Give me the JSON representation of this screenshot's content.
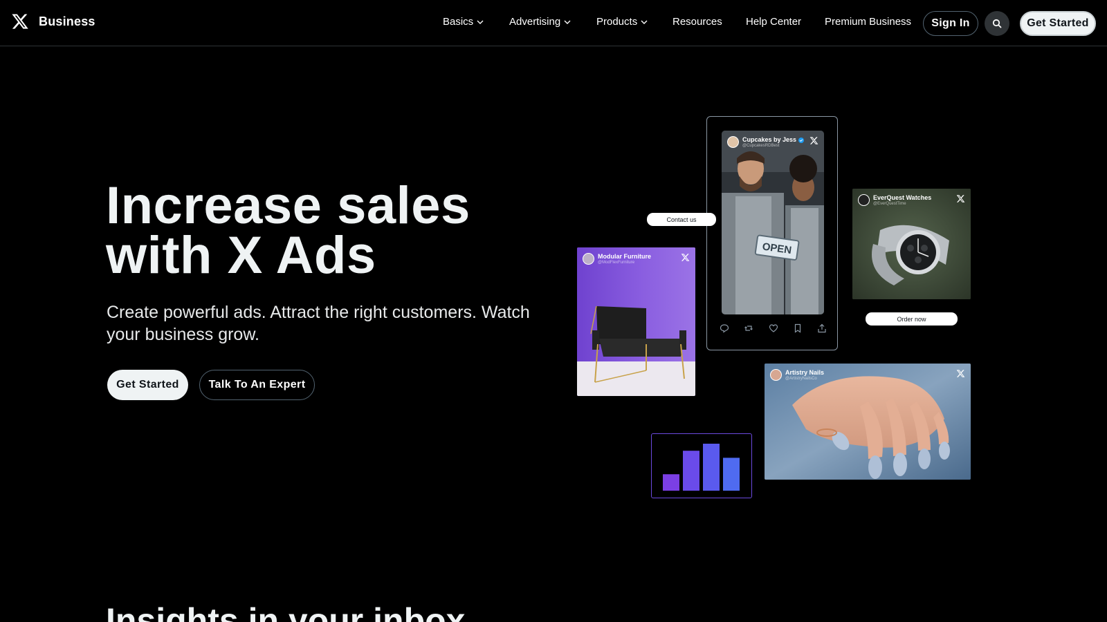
{
  "header": {
    "brand": "Business",
    "nav": [
      {
        "label": "Basics",
        "has_dropdown": true
      },
      {
        "label": "Advertising",
        "has_dropdown": true
      },
      {
        "label": "Products",
        "has_dropdown": true
      },
      {
        "label": "Resources",
        "has_dropdown": false
      },
      {
        "label": "Help Center",
        "has_dropdown": false
      },
      {
        "label": "Premium Business",
        "has_dropdown": false
      }
    ],
    "sign_in": "Sign In",
    "get_started": "Get Started",
    "search_icon": "search-icon"
  },
  "hero": {
    "title_line1": "Increase sales",
    "title_line2": "with X Ads",
    "subtitle": "Create powerful ads. Attract the right customers. Watch your business grow.",
    "primary_cta": "Get Started",
    "secondary_cta": "Talk To An Expert"
  },
  "ads": {
    "cupcakes": {
      "name": "Cupcakes by Jess",
      "handle": "@CupcakesRDBest",
      "verified": true,
      "sign": "OPEN"
    },
    "contact_cta": "Contact us",
    "watches": {
      "name": "EverQuest Watches",
      "handle": "@EverQuestTime"
    },
    "order_cta": "Order now",
    "furniture": {
      "name": "Modular Furniture",
      "handle": "@ModFlexFurniture"
    },
    "nails": {
      "name": "Artistry Nails",
      "handle": "@ArtistryNailsCo"
    }
  },
  "stats_widget": {
    "bars": [
      0.35,
      0.85,
      1.0,
      0.7
    ],
    "colors": [
      "#7b3fe4",
      "#6a4bea",
      "#5a5aee",
      "#4f6bf0"
    ]
  },
  "insights": {
    "title": "Insights in your inbox"
  },
  "colors": {
    "background": "#000000",
    "accent_purple": "#6c4be0",
    "button_light": "#eff3f4"
  }
}
